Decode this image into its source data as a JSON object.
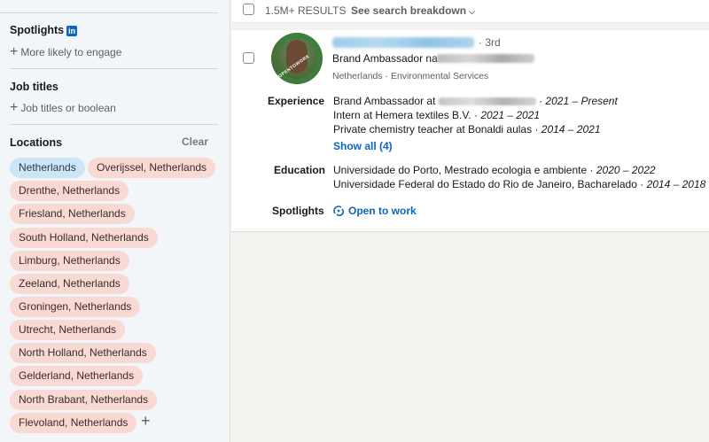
{
  "sidebar": {
    "spotlights": {
      "title": "Spotlights",
      "badge": "in",
      "add_label": "More likely to engage"
    },
    "job_titles": {
      "title": "Job titles",
      "add_label": "Job titles or boolean"
    },
    "locations": {
      "title": "Locations",
      "clear_label": "Clear",
      "chips": [
        {
          "label": "Netherlands",
          "active": true
        },
        {
          "label": "Overijssel, Netherlands",
          "active": false
        },
        {
          "label": "Drenthe, Netherlands",
          "active": false
        },
        {
          "label": "Friesland, Netherlands",
          "active": false
        },
        {
          "label": "South Holland, Netherlands",
          "active": false
        },
        {
          "label": "Limburg, Netherlands",
          "active": false
        },
        {
          "label": "Zeeland, Netherlands",
          "active": false
        },
        {
          "label": "Groningen, Netherlands",
          "active": false
        },
        {
          "label": "Utrecht, Netherlands",
          "active": false
        },
        {
          "label": "North Holland, Netherlands",
          "active": false
        },
        {
          "label": "Gelderland, Netherlands",
          "active": false
        },
        {
          "label": "North Brabant, Netherlands",
          "active": false
        },
        {
          "label": "Flevoland, Netherlands",
          "active": false
        }
      ],
      "add_icon": "+"
    }
  },
  "results_bar": {
    "count": "1.5M+ RESULTS",
    "breakdown_label": "See search breakdown",
    "breakdown_icon": "chevron-down-icon"
  },
  "result": {
    "degree": "· 3rd",
    "headline_prefix": "Brand Ambassador na",
    "location": "Netherlands · Environmental Services",
    "experience_label": "Experience",
    "experience": [
      {
        "prefix": "Brand Ambassador at",
        "period": "2021 – Present"
      },
      {
        "prefix": "Intern at Hemera textiles B.V.",
        "period": "2021 – 2021"
      },
      {
        "prefix": "Private chemistry teacher at Bonaldi aulas",
        "period": "2014 – 2021"
      }
    ],
    "show_all": "Show all (4)",
    "education_label": "Education",
    "education": [
      {
        "prefix": "Universidade do Porto, Mestrado ecologia e ambiente",
        "period": "2020 – 2022"
      },
      {
        "prefix": "Universidade Federal do Estado do Rio de Janeiro, Bacharelado",
        "period": "2014 – 2018"
      }
    ],
    "spotlights_label": "Spotlights",
    "open_to_work": "Open to work",
    "avatar_ring_text": "#OPENTOWORK"
  },
  "colors": {
    "link_blue": "#0a66c2",
    "chip_pink": "#f9d9d4",
    "chip_active_blue": "#cde6f7"
  }
}
